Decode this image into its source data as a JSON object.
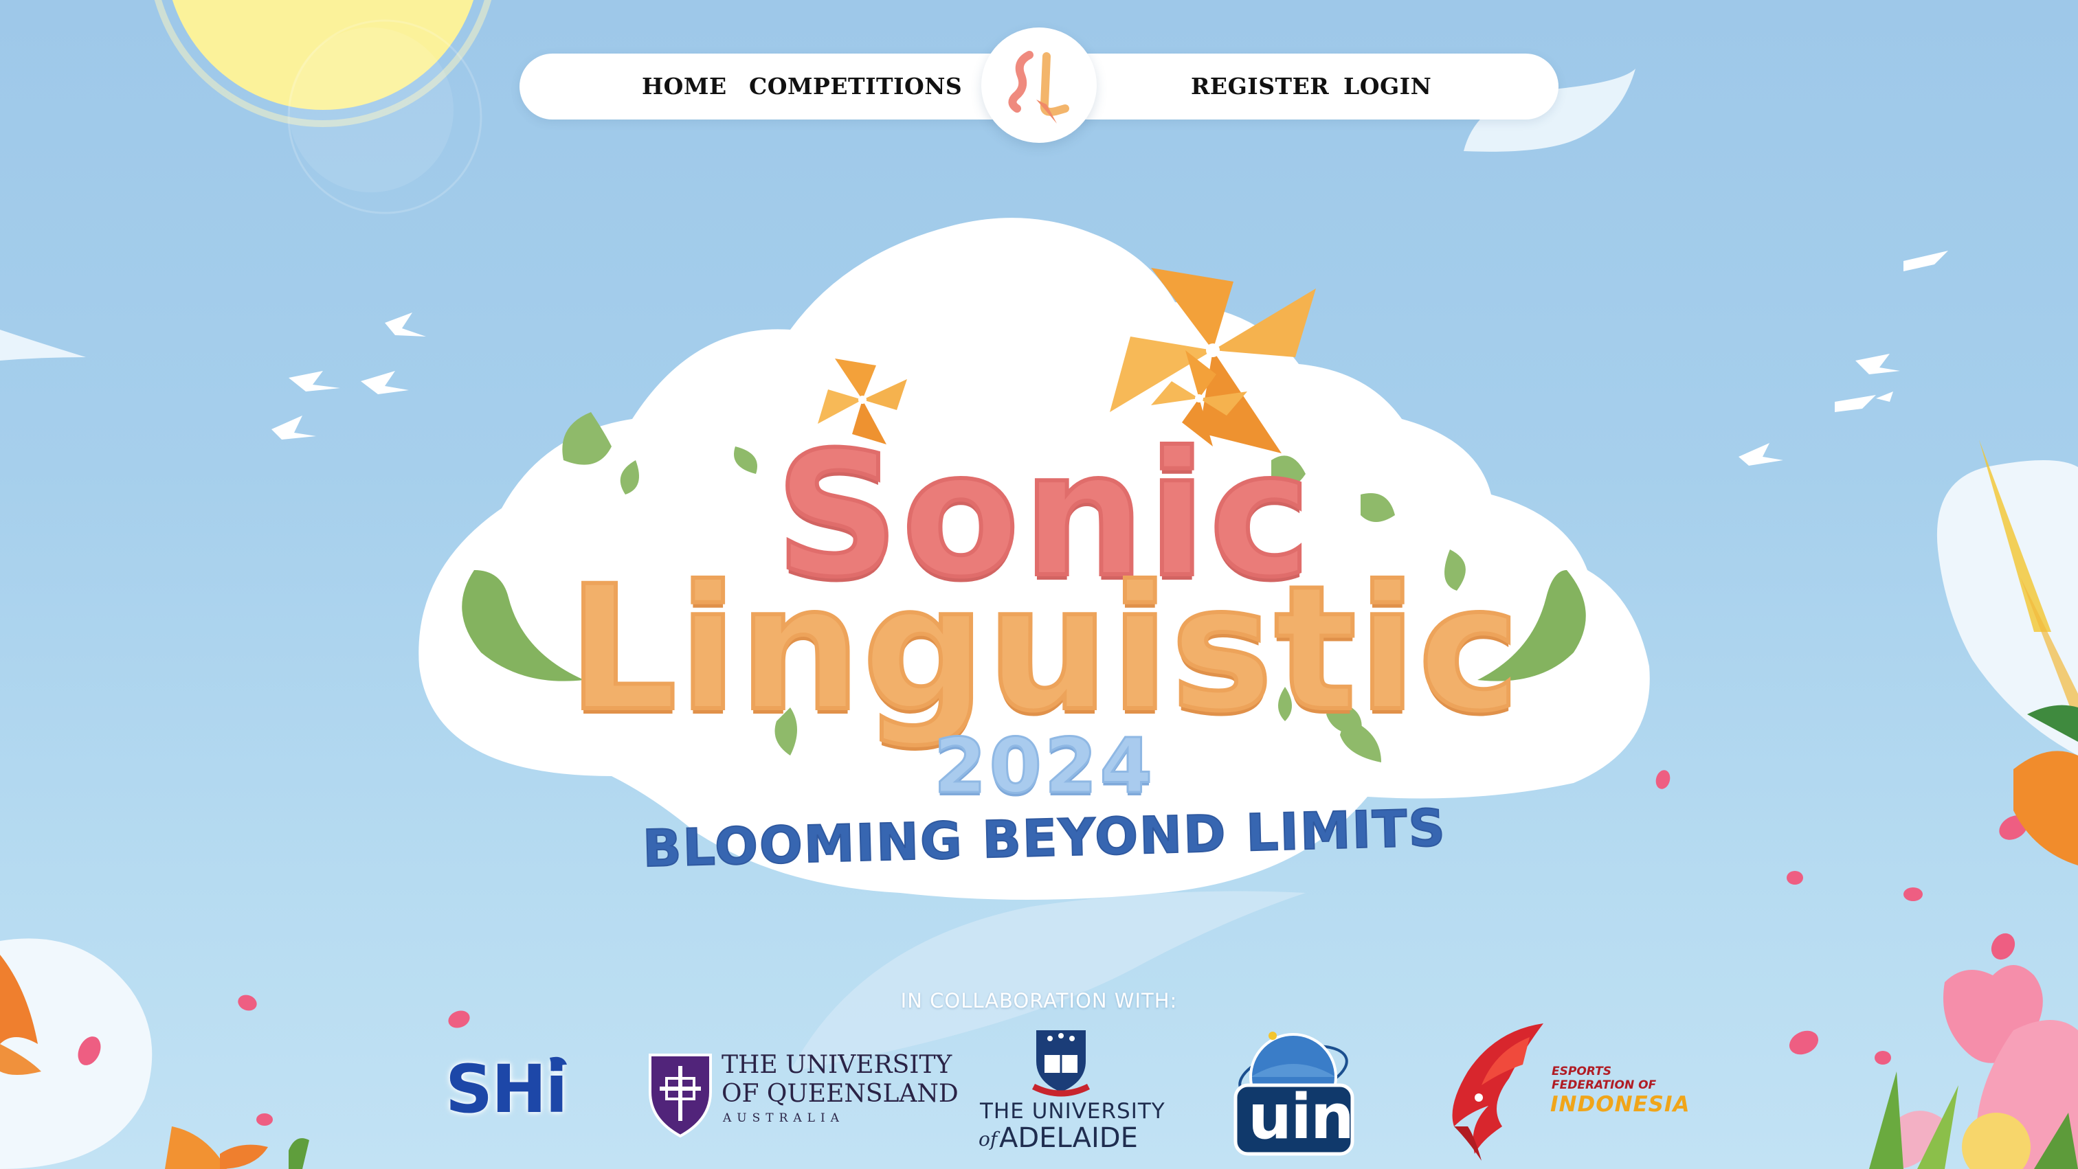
{
  "nav": {
    "links": [
      {
        "label": "HOME"
      },
      {
        "label": "COMPETITIONS"
      },
      {
        "label": "REGISTER"
      },
      {
        "label": "LOGIN"
      }
    ],
    "logo_icon": "sl-monogram-icon"
  },
  "hero": {
    "title_line1": "Sonic",
    "title_line2": "Linguistic",
    "year": "2024",
    "tagline": "BLOOMING BEYOND LIMITS"
  },
  "collaboration": {
    "label": "IN COLLABORATION WITH:",
    "partners": [
      {
        "text": "SHi"
      },
      {
        "line1": "THE UNIVERSITY",
        "line2": "OF QUEENSLAND",
        "line3": "AUSTRALIA"
      },
      {
        "line1": "THE UNIVERSITY",
        "line2_prefix": "of",
        "line2": "ADELAIDE"
      },
      {
        "text": "uin"
      },
      {
        "line1": "ESPORTS",
        "line2": "FEDERATION OF",
        "line3": "INDONESIA"
      }
    ]
  },
  "colors": {
    "sky_top": "#9ec8e9",
    "sonic_pink": "#ea7c79",
    "linguistic_orange": "#f2b06a",
    "year_blue": "#a9cbee",
    "tagline_blue": "#3766b1",
    "pinwheel_orange": "#f3a13a"
  }
}
